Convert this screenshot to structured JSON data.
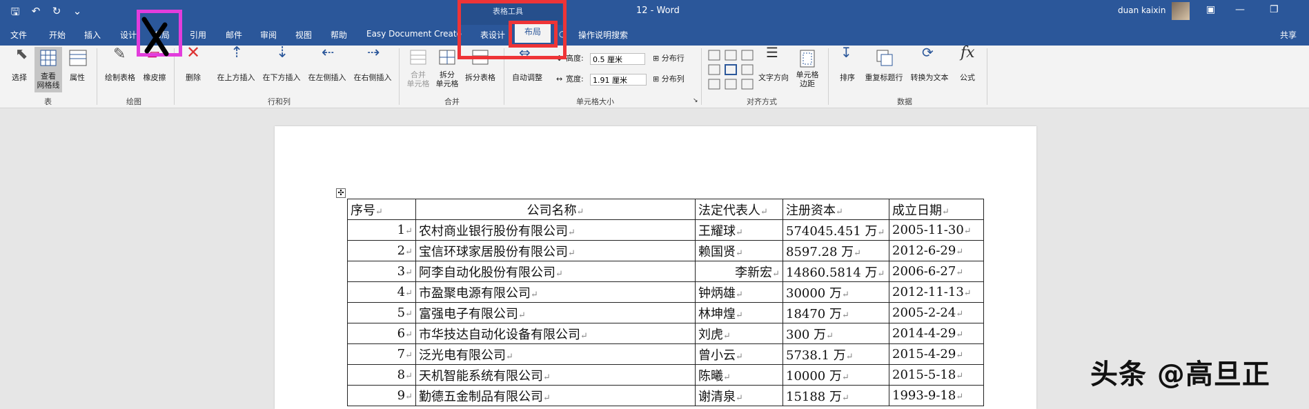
{
  "window": {
    "title": "12  -  Word",
    "context_group": "表格工具",
    "user_name": "duan kaixin",
    "share_label": "共享"
  },
  "tabs": [
    "文件",
    "开始",
    "插入",
    "设计",
    "布局",
    "引用",
    "邮件",
    "审阅",
    "视图",
    "帮助",
    "Easy Document Creato",
    "表设计",
    "布局",
    "操作说明搜索"
  ],
  "ribbon": {
    "table_group": {
      "label": "表",
      "select": "选择",
      "view_grid_1": "查看",
      "view_grid_2": "网格线",
      "properties": "属性"
    },
    "draw_group": {
      "label": "绘图",
      "draw_table": "绘制表格",
      "eraser": "橡皮擦"
    },
    "rows_cols_group": {
      "label": "行和列",
      "delete": "删除",
      "insert_above": "在上方插入",
      "insert_below": "在下方插入",
      "insert_left": "在左侧插入",
      "insert_right": "在右侧插入"
    },
    "merge_group": {
      "label": "合并",
      "merge_1": "合并",
      "merge_2": "单元格",
      "split_cells_1": "拆分",
      "split_cells_2": "单元格",
      "split_table": "拆分表格"
    },
    "cell_size_group": {
      "label": "单元格大小",
      "autofit": "自动调整",
      "height_label": "高度:",
      "height_value": "0.5 厘米",
      "width_label": "宽度:",
      "width_value": "1.91 厘米",
      "distribute_rows": "分布行",
      "distribute_cols": "分布列"
    },
    "align_group": {
      "label": "对齐方式",
      "text_direction": "文字方向",
      "cell_margins_1": "单元格",
      "cell_margins_2": "边距"
    },
    "data_group": {
      "label": "数据",
      "sort": "排序",
      "repeat_header": "重复标题行",
      "convert_text": "转换为文本",
      "formula": "公式"
    }
  },
  "table": {
    "headers": [
      "序号",
      "公司名称",
      "法定代表人",
      "注册资本",
      "成立日期"
    ],
    "rows": [
      [
        "1",
        "农村商业银行股份有限公司",
        "王耀球",
        "574045.451 万",
        "2005-11-30"
      ],
      [
        "2",
        "宝信环球家居股份有限公司",
        "赖国贤",
        "8597.28 万",
        "2012-6-29"
      ],
      [
        "3",
        "阿李自动化股份有限公司",
        "李新宏",
        "14860.5814 万",
        "2006-6-27"
      ],
      [
        "4",
        "市盈聚电源有限公司",
        "钟炳雄",
        "30000 万",
        "2012-11-13"
      ],
      [
        "5",
        "富强电子有限公司",
        "林坤煌",
        "18470 万",
        "2005-2-24"
      ],
      [
        "6",
        "市华技达自动化设备有限公司",
        "刘虎",
        "300 万",
        "2014-4-29"
      ],
      [
        "7",
        "泛光电有限公司",
        "曾小云",
        "5738.1 万",
        "2015-4-29"
      ],
      [
        "8",
        "天机智能系统有限公司",
        "陈曦",
        "10000 万",
        "2015-5-18"
      ],
      [
        "9",
        "勤德五金制品有限公司",
        "谢清泉",
        "15188 万",
        "1993-9-18"
      ]
    ]
  },
  "watermark": "头条 @高旦正",
  "annotations": {
    "scribble_icon": "x-mark",
    "colors": {
      "magenta": "#e23ddc",
      "red": "#ee3437",
      "word_blue": "#2b579a"
    }
  }
}
